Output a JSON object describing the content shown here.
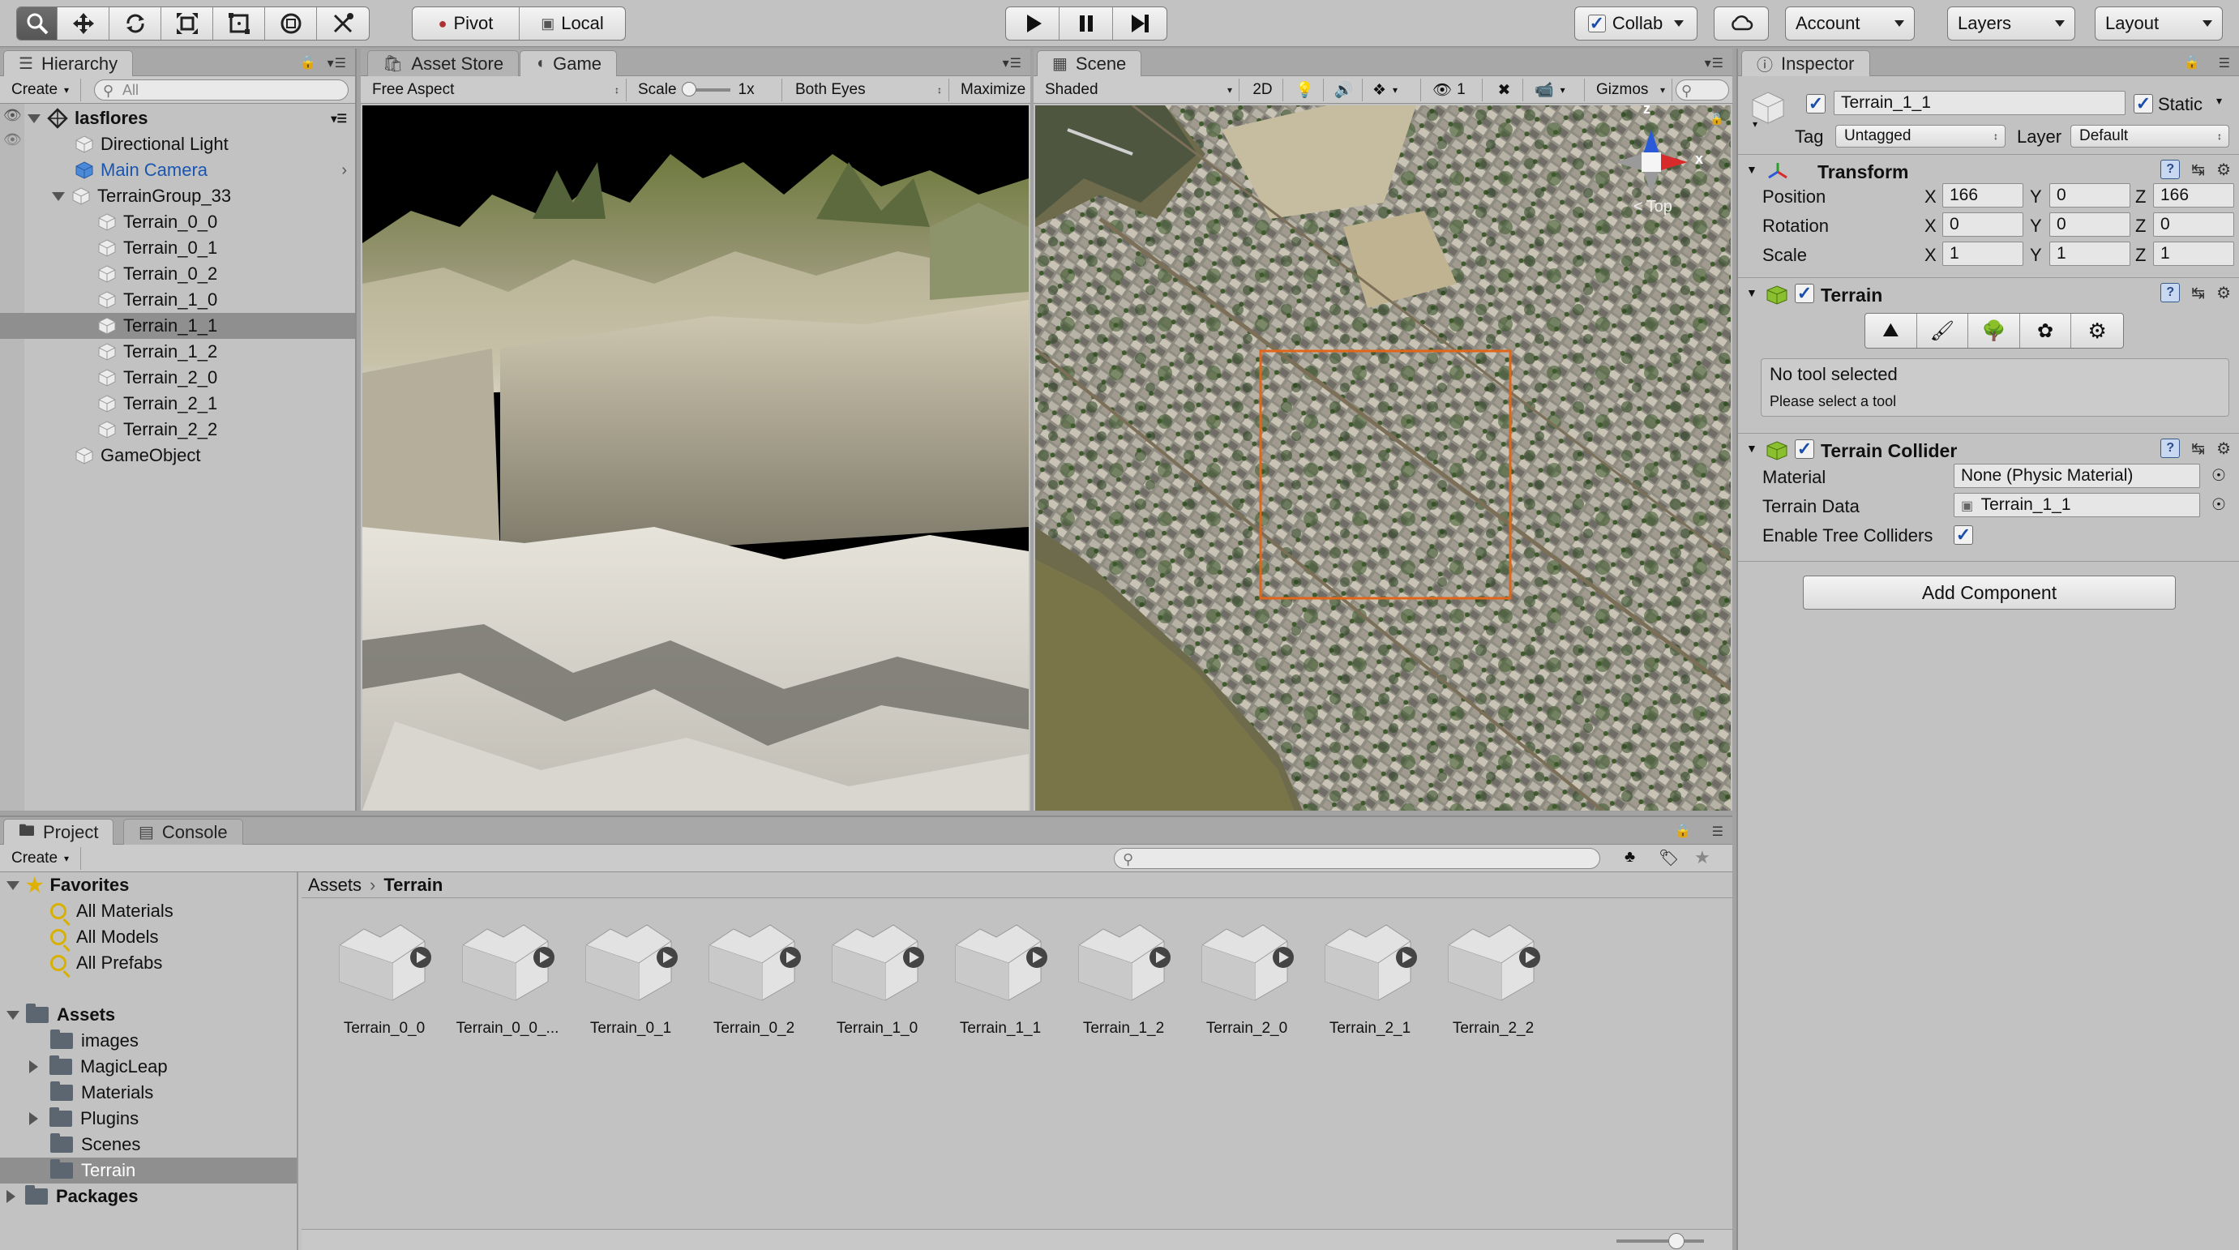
{
  "toolbar": {
    "pivot_label": "Pivot",
    "local_label": "Local",
    "collab_label": "Collab",
    "account_label": "Account",
    "layers_label": "Layers",
    "layout_label": "Layout"
  },
  "hierarchy": {
    "tab_label": "Hierarchy",
    "create_label": "Create",
    "search_placeholder": "All",
    "scene_name": "lasflores",
    "items": [
      {
        "label": "Directional Light"
      },
      {
        "label": "Main Camera"
      },
      {
        "label": "TerrainGroup_33"
      },
      {
        "label": "Terrain_0_0"
      },
      {
        "label": "Terrain_0_1"
      },
      {
        "label": "Terrain_0_2"
      },
      {
        "label": "Terrain_1_0"
      },
      {
        "label": "Terrain_1_1"
      },
      {
        "label": "Terrain_1_2"
      },
      {
        "label": "Terrain_2_0"
      },
      {
        "label": "Terrain_2_1"
      },
      {
        "label": "Terrain_2_2"
      },
      {
        "label": "GameObject"
      }
    ]
  },
  "game": {
    "asset_store_tab": "Asset Store",
    "game_tab": "Game",
    "aspect": "Free Aspect",
    "scale_label": "Scale",
    "scale_value": "1x",
    "eyes": "Both Eyes",
    "maximize": "Maximize On"
  },
  "scene": {
    "tab_label": "Scene",
    "shading": "Shaded",
    "mode_2d": "2D",
    "hidden_count": "1",
    "gizmos": "Gizmos",
    "axis_z": "z",
    "axis_x": "x",
    "view_label": "Top"
  },
  "inspector": {
    "tab_label": "Inspector",
    "object_name": "Terrain_1_1",
    "static_label": "Static",
    "tag_label": "Tag",
    "tag_value": "Untagged",
    "layer_label": "Layer",
    "layer_value": "Default",
    "transform": {
      "title": "Transform",
      "position_label": "Position",
      "rotation_label": "Rotation",
      "scale_label": "Scale",
      "x_label": "X",
      "y_label": "Y",
      "z_label": "Z",
      "position": [
        "166",
        "0",
        "166"
      ],
      "rotation": [
        "0",
        "0",
        "0"
      ],
      "scale": [
        "1",
        "1",
        "1"
      ]
    },
    "terrain": {
      "title": "Terrain",
      "no_tool": "No tool selected",
      "please_select": "Please select a tool"
    },
    "collider": {
      "title": "Terrain Collider",
      "material_label": "Material",
      "material_value": "None (Physic Material)",
      "data_label": "Terrain Data",
      "data_value": "Terrain_1_1",
      "trees_label": "Enable Tree Colliders"
    },
    "add_component": "Add Component"
  },
  "project": {
    "project_tab": "Project",
    "console_tab": "Console",
    "create_label": "Create",
    "favorites_label": "Favorites",
    "favorites": [
      {
        "label": "All Materials"
      },
      {
        "label": "All Models"
      },
      {
        "label": "All Prefabs"
      }
    ],
    "assets_label": "Assets",
    "folders": [
      {
        "label": "images"
      },
      {
        "label": "MagicLeap"
      },
      {
        "label": "Materials"
      },
      {
        "label": "Plugins"
      },
      {
        "label": "Scenes"
      },
      {
        "label": "Terrain"
      }
    ],
    "packages_label": "Packages",
    "breadcrumb_root": "Assets",
    "breadcrumb_current": "Terrain",
    "assets": [
      {
        "label": "Terrain_0_0"
      },
      {
        "label": "Terrain_0_0_..."
      },
      {
        "label": "Terrain_0_1"
      },
      {
        "label": "Terrain_0_2"
      },
      {
        "label": "Terrain_1_0"
      },
      {
        "label": "Terrain_1_1"
      },
      {
        "label": "Terrain_1_2"
      },
      {
        "label": "Terrain_2_0"
      },
      {
        "label": "Terrain_2_1"
      },
      {
        "label": "Terrain_2_2"
      }
    ]
  },
  "colors": {
    "selection": "#8f8f8f",
    "link_blue": "#1a56b0",
    "selection_box": "#e0661c"
  }
}
